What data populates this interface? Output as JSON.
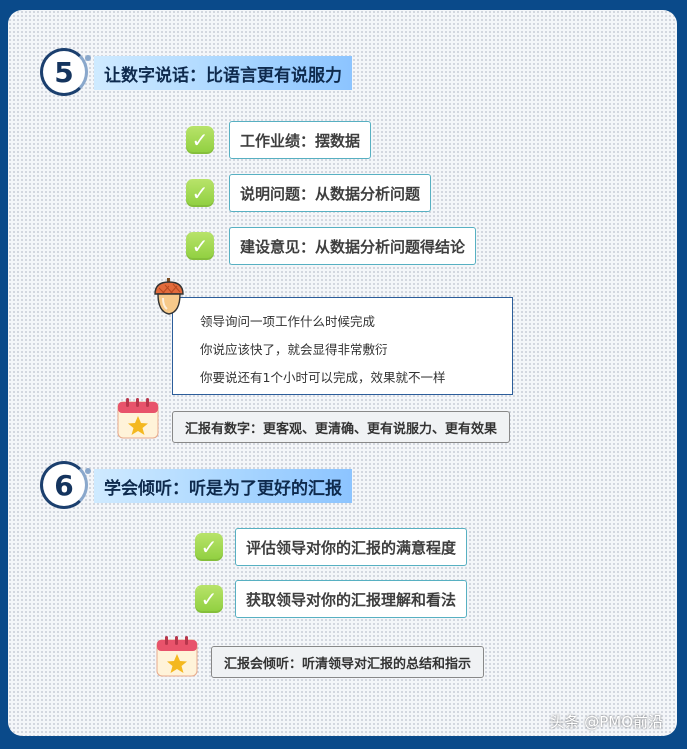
{
  "sections": [
    {
      "number": "5",
      "title": "让数字说话：比语言更有说服力",
      "points": [
        "工作业绩：摆数据",
        "说明问题：从数据分析问题",
        "建设意见：从数据分析问题得结论"
      ],
      "quote_lines": [
        "领导询问一项工作什么时候完成",
        "你说应该快了，就会显得非常敷衍",
        "你要说还有1个小时可以完成，效果就不一样"
      ],
      "summary": "汇报有数字：更客观、更清确、更有说服力、更有效果"
    },
    {
      "number": "6",
      "title": "学会倾听：听是为了更好的汇报",
      "points": [
        "评估领导对你的汇报的满意程度",
        "获取领导对你的汇报理解和看法"
      ],
      "summary": "汇报会倾听：听清领导对汇报的总结和指示"
    }
  ],
  "watermark": "头条 @PMO前沿",
  "icons": {
    "check": "check-icon",
    "acorn": "acorn-icon",
    "calendar": "calendar-star-icon"
  },
  "colors": {
    "background": "#0a4a8a",
    "title_gradient": "#a9d6ff",
    "check": "#8fcf3f",
    "pill_border": "#57b0c2"
  }
}
